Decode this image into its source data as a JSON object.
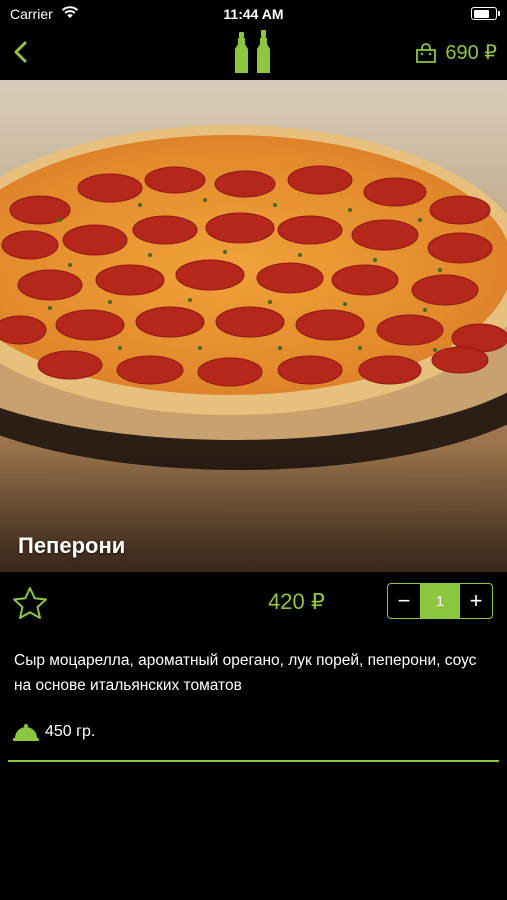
{
  "status_bar": {
    "carrier": "Carrier",
    "time": "11:44 AM"
  },
  "nav": {
    "back_icon": "chevron-left-icon",
    "logo_icon": "salt-pepper-logo-icon",
    "cart_icon": "shopping-bag-icon",
    "cart_total": "690 ₽"
  },
  "product": {
    "image": "pepperoni-pizza-photo",
    "title": "Пеперони",
    "price": "420 ₽",
    "quantity": "1",
    "minus_label": "−",
    "plus_label": "+",
    "description": "Сыр моцарелла, ароматный орегано, лук порей, пеперони, соус на основе итальянских томатов",
    "weight": "450 гр."
  },
  "colors": {
    "accent": "#8dc63f",
    "background": "#000000"
  }
}
